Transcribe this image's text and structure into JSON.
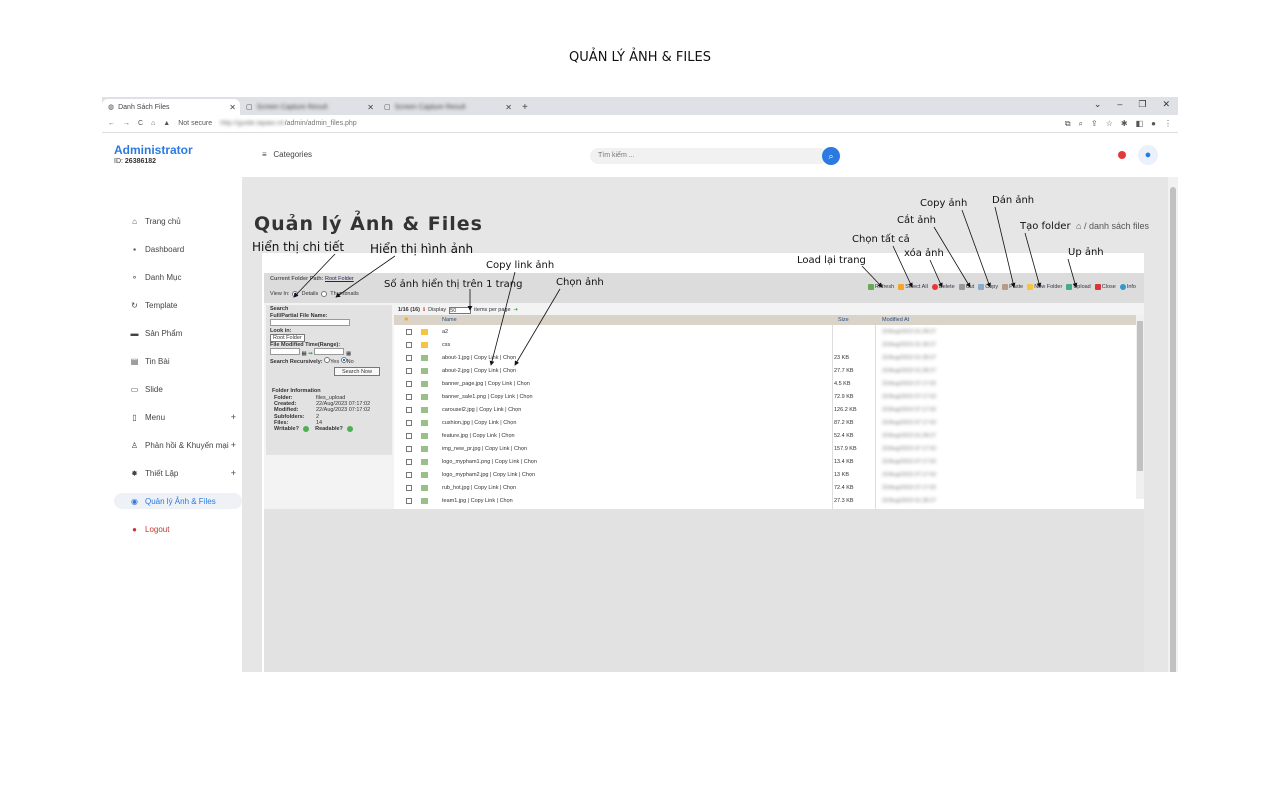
{
  "doc_title": "QUẢN LÝ ẢNH & FILES",
  "browser": {
    "tabs": [
      {
        "label": "Danh Sách Files",
        "icon": "globe-icon"
      },
      {
        "label": "Screen Capture Result",
        "icon": "image-icon"
      },
      {
        "label": "Screen Capture Result",
        "icon": "image-icon"
      }
    ],
    "new_tab": "+",
    "not_secure": "Not secure",
    "url_host": "http://guide.lapaio.vn",
    "url_path": "/admin/admin_files.php"
  },
  "sidebar": {
    "brand": "Administrator",
    "id_label": "ID:",
    "id_value": "26386182",
    "items": [
      {
        "label": "Trang chủ",
        "icon": "home-icon"
      },
      {
        "label": "Dashboard",
        "icon": "grid-icon"
      },
      {
        "label": "Danh Mục",
        "icon": "tag-icon"
      },
      {
        "label": "Template",
        "icon": "refresh-icon"
      },
      {
        "label": "Sản Phẩm",
        "icon": "box-icon"
      },
      {
        "label": "Tin Bài",
        "icon": "news-icon"
      },
      {
        "label": "Slide",
        "icon": "monitor-icon"
      },
      {
        "label": "Menu",
        "icon": "menu-icon",
        "plus": "+"
      },
      {
        "label": "Phản hồi & Khuyến mại",
        "icon": "user-icon",
        "plus": "+"
      },
      {
        "label": "Thiết Lập",
        "icon": "gear-icon",
        "plus": "+"
      },
      {
        "label": "Quản lý Ảnh & Files",
        "icon": "image-icon"
      },
      {
        "label": "Logout",
        "icon": "power-icon"
      }
    ]
  },
  "topbar": {
    "categories": "Categories",
    "search_placeholder": "Tìm kiếm ..."
  },
  "page": {
    "title": "Quản lý Ảnh & Files",
    "breadcrumb": "/ danh sách files"
  },
  "fm": {
    "current_path_label": "Current Folder Path:",
    "current_path_value": "Root Folder",
    "view_in": "View In:",
    "details": "Details",
    "thumbnails": "Thumbnails",
    "toolbar": [
      "Refresh",
      "Select All",
      "Delete",
      "Cut",
      "Copy",
      "Paste",
      "New Folder",
      "Upload",
      "Close",
      "Info"
    ],
    "search_title": "Search",
    "file_name_label": "Full/Partial File Name:",
    "look_in_label": "Look in:",
    "look_in_value": "Root Folder",
    "modified_label": "File Modified Time(Range):",
    "recursive_label": "Search Recursively:",
    "yes": "Yes",
    "no": "No",
    "search_now": "Search Now",
    "info_title": "Folder Information",
    "info": [
      {
        "k": "Folder:",
        "v": "files_upload"
      },
      {
        "k": "Created:",
        "v": "22/Aug/2023 07:17:02"
      },
      {
        "k": "Modified:",
        "v": "22/Aug/2023 07:17:02"
      },
      {
        "k": "Subfolders:",
        "v": "2"
      },
      {
        "k": "Files:",
        "v": "14"
      }
    ],
    "writable": "Writable?",
    "readable": "Readable?",
    "count": "1/16 (16)",
    "display": "Display",
    "per_page": "50",
    "items_per_page": "items per page",
    "col_name": "Name",
    "col_size": "Size",
    "col_modified": "Modified At",
    "rows": [
      {
        "name": "a2",
        "type": "folder",
        "size": "",
        "mod": "22/Aug/2023 01:28:27"
      },
      {
        "name": "css",
        "type": "folder",
        "size": "",
        "mod": "22/Aug/2023 01:28:27"
      },
      {
        "name": "about-1.jpg | Copy Link | Chọn",
        "type": "img",
        "size": "23 KB",
        "mod": "22/Aug/2023 01:28:27"
      },
      {
        "name": "about-2.jpg | Copy Link | Chọn",
        "type": "img",
        "size": "27.7 KB",
        "mod": "22/Aug/2023 01:28:27"
      },
      {
        "name": "banner_page.jpg | Copy Link | Chọn",
        "type": "img",
        "size": "4.5 KB",
        "mod": "22/Aug/2023 07:17:02"
      },
      {
        "name": "banner_sale1.png | Copy Link | Chọn",
        "type": "img",
        "size": "72.9 KB",
        "mod": "22/Aug/2023 07:17:02"
      },
      {
        "name": "carousel2.jpg | Copy Link | Chọn",
        "type": "img",
        "size": "126.2 KB",
        "mod": "22/Aug/2023 07:17:02"
      },
      {
        "name": "cushion.jpg | Copy Link | Chọn",
        "type": "img",
        "size": "87.2 KB",
        "mod": "22/Aug/2023 07:17:02"
      },
      {
        "name": "feature.jpg | Copy Link | Chọn",
        "type": "img",
        "size": "52.4 KB",
        "mod": "22/Aug/2023 01:28:27"
      },
      {
        "name": "img_new_pr.jpg | Copy Link | Chọn",
        "type": "img",
        "size": "157.9 KB",
        "mod": "22/Aug/2023 07:17:02"
      },
      {
        "name": "logo_mypham1.png | Copy Link | Chọn",
        "type": "img",
        "size": "13.4 KB",
        "mod": "22/Aug/2023 07:17:02"
      },
      {
        "name": "logo_mypham2.jpg | Copy Link | Chọn",
        "type": "img",
        "size": "13 KB",
        "mod": "22/Aug/2023 07:17:02"
      },
      {
        "name": "rub_hot.jpg | Copy Link | Chọn",
        "type": "img",
        "size": "72.4 KB",
        "mod": "22/Aug/2023 07:17:02"
      },
      {
        "name": "team1.jpg | Copy Link | Chọn",
        "type": "img",
        "size": "27.3 KB",
        "mod": "22/Aug/2023 01:28:27"
      }
    ]
  },
  "annotations": {
    "chi_tiet": "Hiển thị chi tiết",
    "hinh_anh": "Hiển thị hình ảnh",
    "copy_link": "Copy link ảnh",
    "so_anh": "Số ảnh hiển thị trên 1 trang",
    "chon_anh": "Chọn ảnh",
    "load_lai": "Load lại trang",
    "chon_tat_ca": "Chọn tất cả",
    "xoa_anh": "xóa ảnh",
    "cat_anh": "Cắt ảnh",
    "copy_anh": "Copy ảnh",
    "dan_anh": "Dán ảnh",
    "tao_folder": "Tạo folder",
    "up_anh": "Up ảnh"
  }
}
